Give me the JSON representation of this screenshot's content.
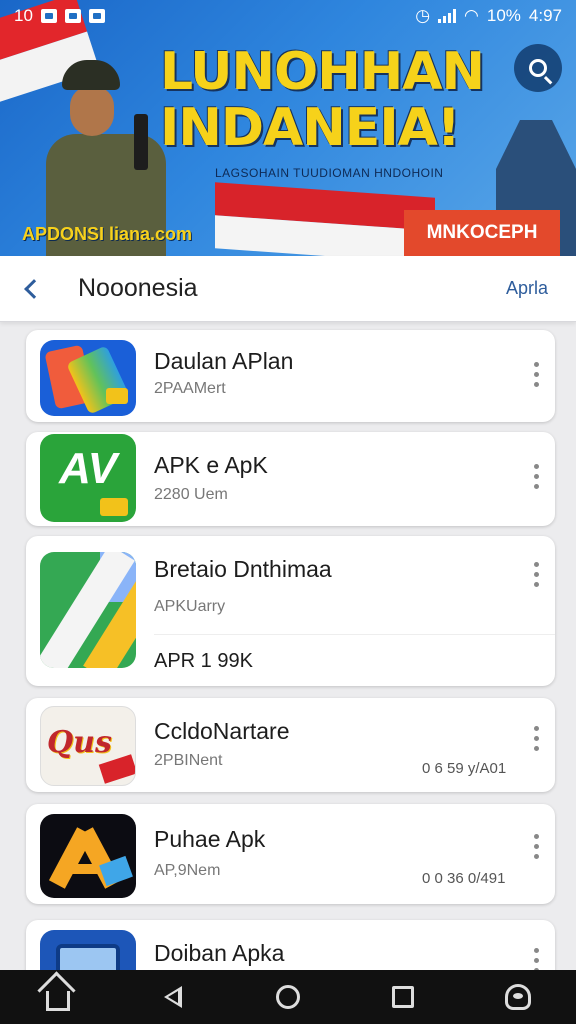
{
  "status": {
    "left_text": "10",
    "battery": "10%",
    "time": "4:97"
  },
  "banner": {
    "headline_line1": "LUNOHHAN",
    "headline_line2": "INDANEIA!",
    "subline": "LAGSOHAIN TUUDIOMAN HNDOHOIN",
    "site": "APDONSI lianа.com",
    "download_label": "MNKOCEPH"
  },
  "header": {
    "title": "Nooonesia",
    "action": "Aprlа"
  },
  "apps": [
    {
      "name": "Daulan APlan",
      "meta": "2PAAMert",
      "extra": ""
    },
    {
      "name": "APK e ApK",
      "meta": "2280 Uem",
      "extra": ""
    },
    {
      "name": "Bretaio Dnthimaa",
      "meta": "APKUarry",
      "extra": "APR 1 99K"
    },
    {
      "name": "CcldoNartare",
      "meta": "2PBINent",
      "extra": "0 6 59 y/A01"
    },
    {
      "name": "Puhae Apk",
      "meta": "AP,9Nem",
      "extra": "0 0 36 0/491"
    },
    {
      "name": "Doiban Apka",
      "meta": "",
      "extra": ""
    }
  ],
  "icons": {
    "app1": "phone-cards-icon",
    "app2": "apk-av-icon",
    "app3": "maps-icon",
    "app4": "script-logo-icon",
    "app5": "a-letter-icon",
    "app6": "window-icon"
  },
  "colors": {
    "accent": "#2e5d9c",
    "banner_bg": "#2f86de",
    "headline": "#f6d21a",
    "download_btn": "#e3492c"
  }
}
